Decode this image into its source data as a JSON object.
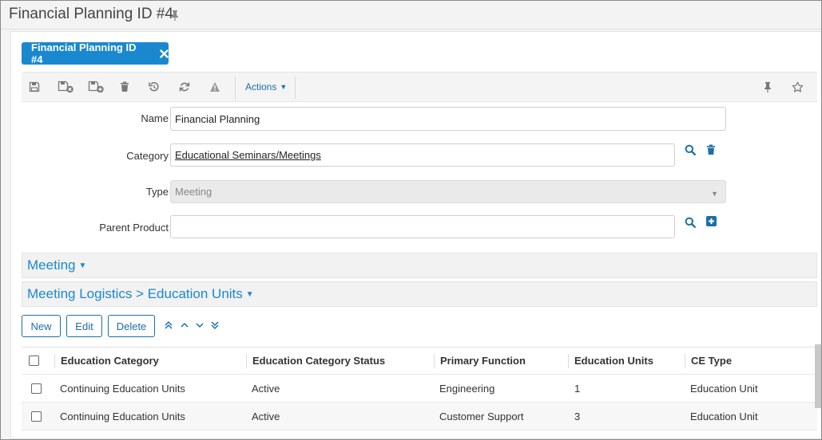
{
  "window": {
    "title": "Financial Planning ID #4"
  },
  "tab": {
    "label": "Financial Planning ID #4"
  },
  "toolbar": {
    "icons": [
      "save-icon",
      "save-close-icon",
      "save-new-icon",
      "delete-icon",
      "history-icon",
      "refresh-icon",
      "warning-icon"
    ],
    "actions_label": "Actions",
    "right_icons": [
      "pin-icon",
      "star-icon"
    ]
  },
  "form": {
    "name_label": "Name",
    "name_value": "Financial Planning",
    "category_label": "Category",
    "category_value": "Educational Seminars/Meetings",
    "type_label": "Type",
    "type_value": "Meeting",
    "parent_label": "Parent Product",
    "parent_value": ""
  },
  "sections": {
    "meeting": "Meeting",
    "logistics": "Meeting Logistics > Education Units"
  },
  "grid_toolbar": {
    "new_label": "New",
    "edit_label": "Edit",
    "delete_label": "Delete"
  },
  "table": {
    "columns": [
      "Education Category",
      "Education Category Status",
      "Primary Function",
      "Education Units",
      "CE Type"
    ],
    "rows": [
      [
        "Continuing Education Units",
        "Active",
        "Engineering",
        "1",
        "Education Unit"
      ],
      [
        "Continuing Education Units",
        "Active",
        "Customer Support",
        "3",
        "Education Unit"
      ]
    ]
  },
  "colors": {
    "accent": "#1a88cf",
    "link": "#1a6fa8"
  }
}
